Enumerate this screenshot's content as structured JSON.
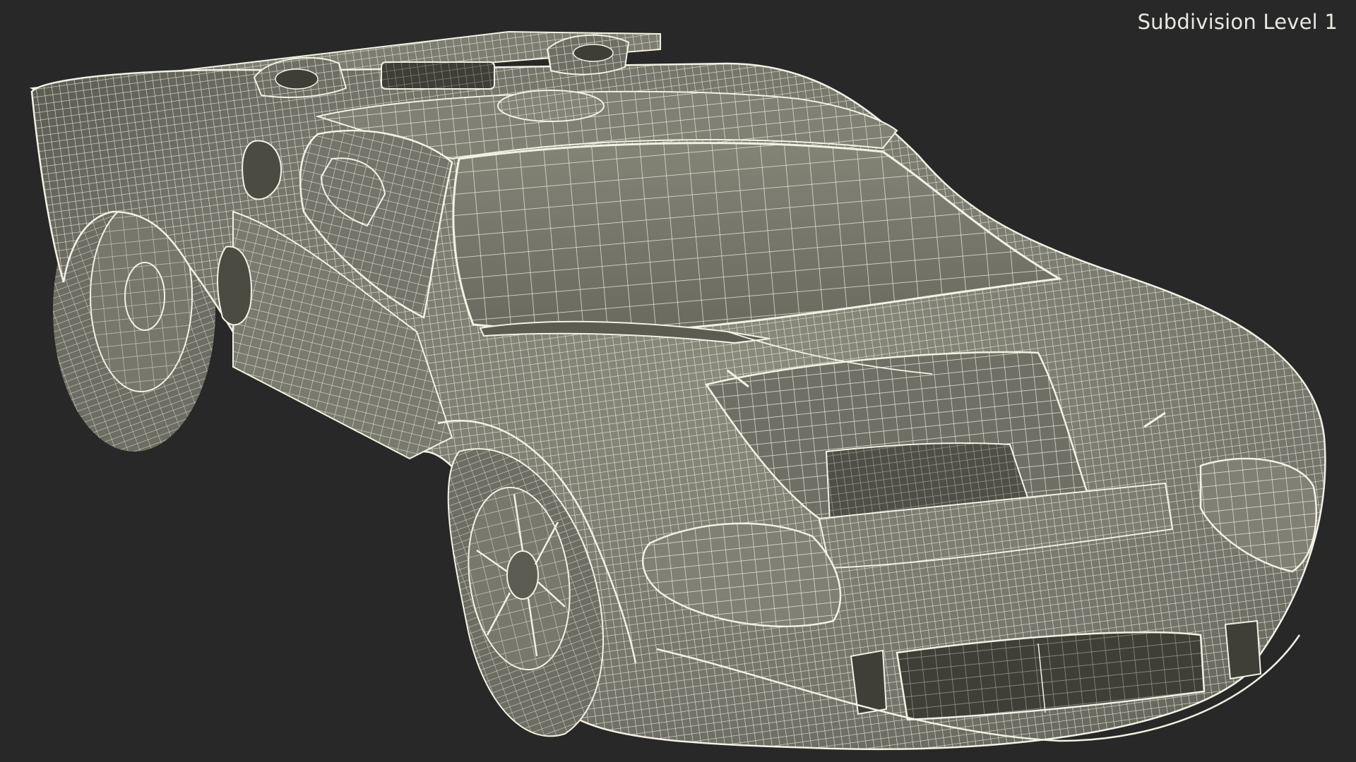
{
  "viewport": {
    "background_color": "#282828",
    "caption": "Subdivision Level 1"
  },
  "render": {
    "subject_icon": "car-wireframe-icon",
    "body_color": "#77776b",
    "wire_color": "#f3f1e3",
    "shadow_color": "#4b4b42"
  }
}
